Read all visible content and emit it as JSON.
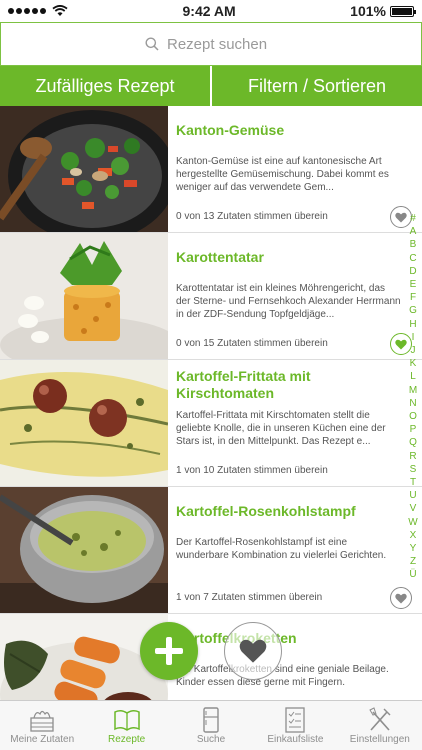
{
  "status": {
    "time": "9:42 AM",
    "battery": "101%",
    "battery_level": 1.0
  },
  "search": {
    "placeholder": "Rezept suchen"
  },
  "actions": {
    "random": "Zufälliges Rezept",
    "filter": "Filtern / Sortieren"
  },
  "recipes": [
    {
      "title": "Kanton-Gemüse",
      "description": "Kanton-Gemüse ist eine auf kantonesische Art hergestellte Gemüsemischung. Dabei kommt es weniger auf das verwendete Gem...",
      "match": "0 von 13 Zutaten stimmen überein",
      "favorite": false
    },
    {
      "title": "Karottentatar",
      "description": "Karottentatar ist ein kleines Möhrengericht, das der Sterne- und Fernsehkoch Alexander Herrmann in der ZDF-Sendung Topfgeldjäge...",
      "match": "0 von 15 Zutaten stimmen überein",
      "favorite": true
    },
    {
      "title": "Kartoffel-Frittata mit Kirschtomaten",
      "description": "Kartoffel-Frittata mit Kirschtomaten stellt die geliebte Knolle, die in unseren Küchen eine der Stars ist, in den Mittelpunkt. Das Rezept e...",
      "match": "1 von 10 Zutaten stimmen überein",
      "favorite": false
    },
    {
      "title": "Kartoffel-Rosenkohlstampf",
      "description": "Der Kartoffel-Rosenkohlstampf ist eine wunderbare Kombination zu vielerlei Gerichten.",
      "match": "1 von 7 Zutaten stimmen überein",
      "favorite": false
    },
    {
      "title": "Kartoffelkroketten",
      "description": "Die Kartoffelkroketten sind eine geniale Beilage. Kinder essen diese gerne mit Fingern.",
      "match": "",
      "favorite": false
    }
  ],
  "alphabet": [
    "#",
    "A",
    "B",
    "C",
    "D",
    "E",
    "F",
    "G",
    "H",
    "I",
    "J",
    "K",
    "L",
    "M",
    "N",
    "O",
    "P",
    "Q",
    "R",
    "S",
    "T",
    "U",
    "V",
    "W",
    "X",
    "Y",
    "Z",
    "Ü"
  ],
  "tabs": [
    {
      "label": "Meine Zutaten",
      "icon": "crate-icon"
    },
    {
      "label": "Rezepte",
      "icon": "book-icon"
    },
    {
      "label": "Suche",
      "icon": "fridge-icon"
    },
    {
      "label": "Einkaufsliste",
      "icon": "checklist-icon"
    },
    {
      "label": "Einstellungen",
      "icon": "utensils-icon"
    }
  ],
  "colors": {
    "accent": "#6cb829",
    "text": "#555555",
    "inactive": "#8e8e8e"
  }
}
